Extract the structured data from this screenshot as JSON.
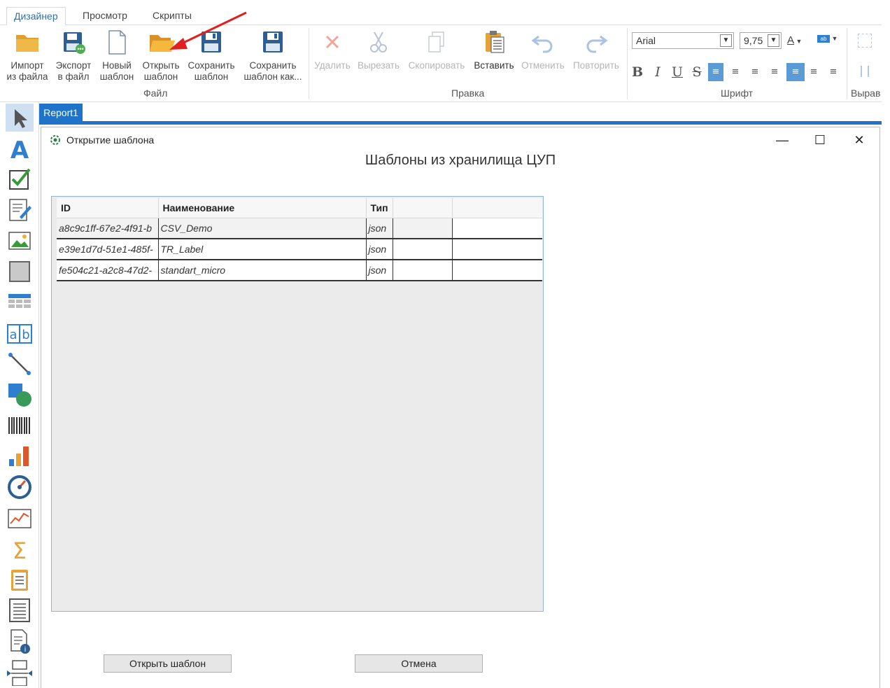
{
  "ribbon": {
    "tabs": [
      {
        "label": "Дизайнер",
        "active": true
      },
      {
        "label": "Просмотр",
        "active": false
      },
      {
        "label": "Скрипты",
        "active": false
      }
    ],
    "file_group": {
      "label": "Файл",
      "buttons": [
        {
          "line1": "Импорт",
          "line2": "из файла",
          "icon": "folder-icon"
        },
        {
          "line1": "Экспорт",
          "line2": "в файл",
          "icon": "export-icon"
        },
        {
          "line1": "Новый",
          "line2": "шаблон",
          "icon": "new-page-icon"
        },
        {
          "line1": "Открыть",
          "line2": "шаблон",
          "icon": "open-folder-icon"
        },
        {
          "line1": "Сохранить",
          "line2": "шаблон",
          "icon": "save-icon"
        },
        {
          "line1": "Сохранить",
          "line2": "шаблон как...",
          "icon": "save-as-icon"
        }
      ]
    },
    "edit_group": {
      "label": "Правка",
      "buttons": [
        {
          "label": "Удалить",
          "icon": "delete-icon",
          "enabled": false
        },
        {
          "label": "Вырезать",
          "icon": "cut-icon",
          "enabled": false
        },
        {
          "label": "Скопировать",
          "icon": "copy-icon",
          "enabled": false
        },
        {
          "label": "Вставить",
          "icon": "paste-icon",
          "enabled": true
        },
        {
          "label": "Отменить",
          "icon": "undo-icon",
          "enabled": false
        },
        {
          "label": "Повторить",
          "icon": "redo-icon",
          "enabled": false
        }
      ]
    },
    "font_group": {
      "label": "Шрифт",
      "font_name": "Arial",
      "font_size": "9,75",
      "bold": "B",
      "italic": "I",
      "underline": "U",
      "strike": "S"
    },
    "align_group": {
      "label": "Вырав"
    }
  },
  "document": {
    "tab_label": "Report1"
  },
  "dialog": {
    "title": "Открытие шаблона",
    "heading": "Шаблоны из хранилища ЦУП",
    "columns": [
      "ID",
      "Наименование",
      "Тип",
      ""
    ],
    "rows": [
      {
        "id": "a8c9c1ff-67e2-4f91-b",
        "name": "CSV_Demo",
        "type": "json"
      },
      {
        "id": "e39e1d7d-51e1-485f-",
        "name": "TR_Label",
        "type": "json"
      },
      {
        "id": "fe504c21-a2c8-47d2-",
        "name": "standart_micro",
        "type": "json"
      }
    ],
    "open_button": "Открыть шаблон",
    "cancel_button": "Отмена",
    "minimize": "—",
    "maximize": "☐",
    "close": "✕"
  },
  "colors": {
    "accent": "#1f73c8",
    "arrow": "#e02020"
  }
}
